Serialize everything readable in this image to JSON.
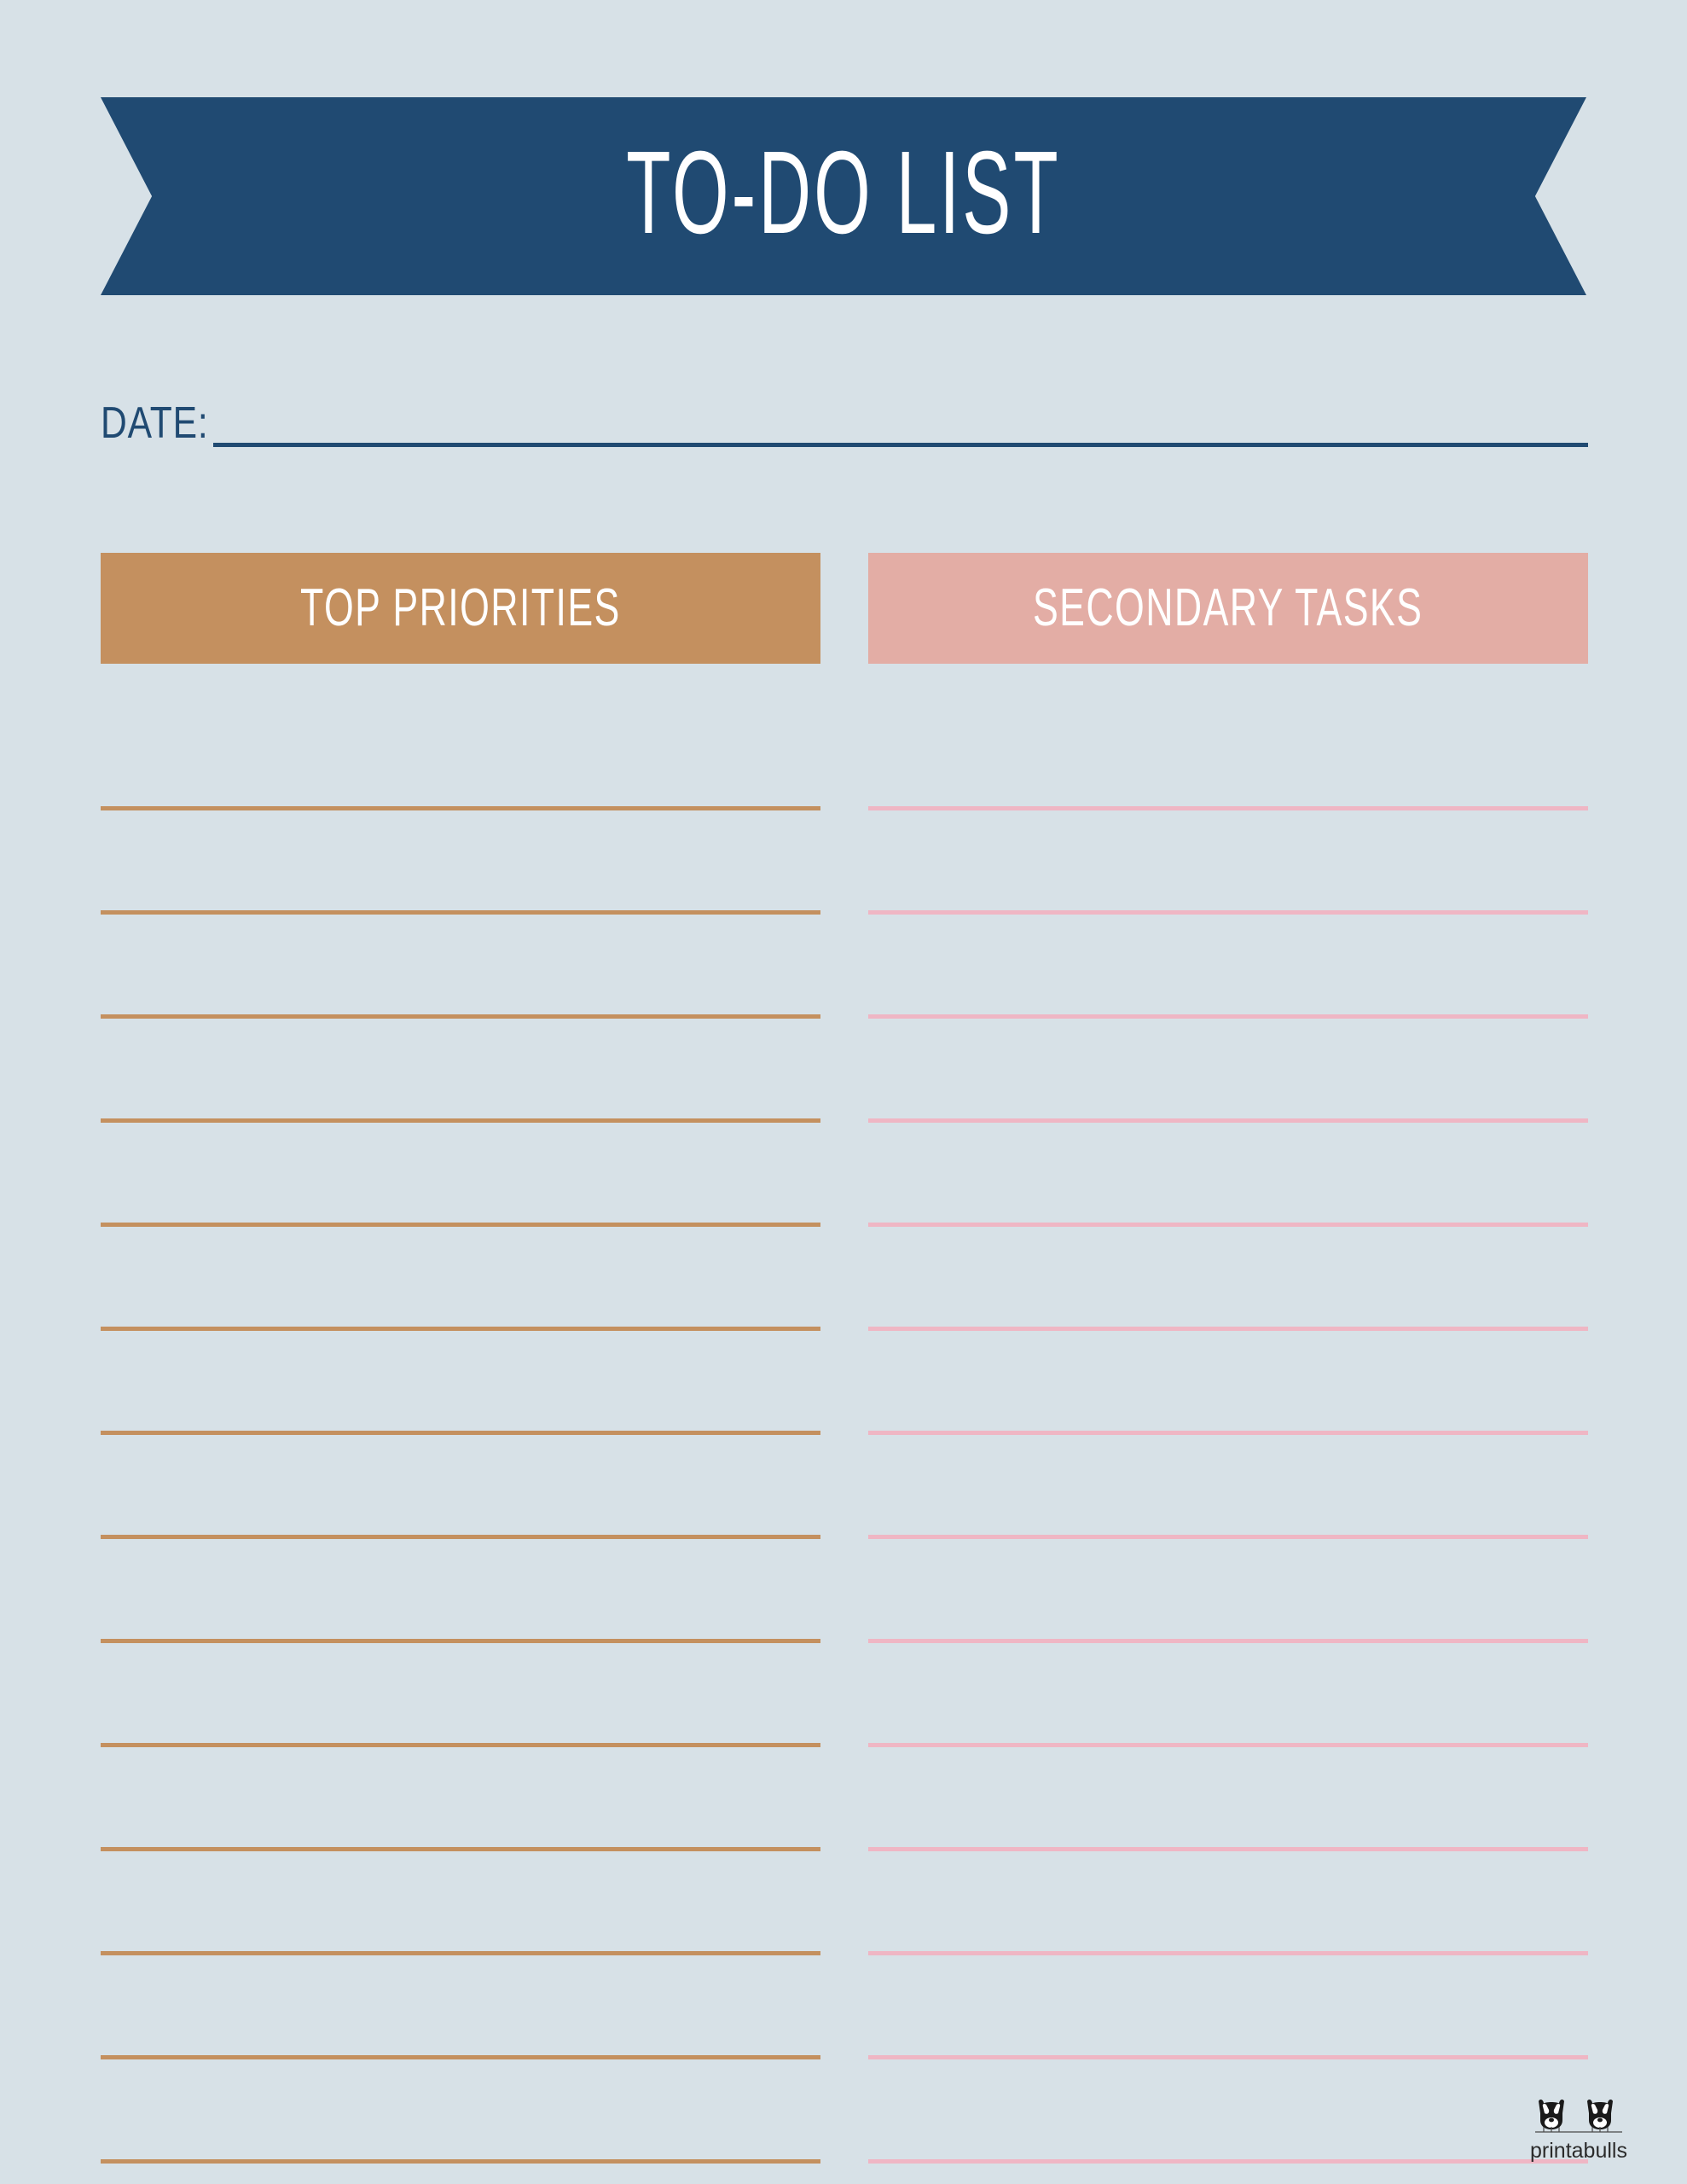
{
  "document": {
    "title": "TO-DO LIST",
    "background_color": "#d7e1e7"
  },
  "banner": {
    "title": "TO-DO LIST",
    "background_color": "#204a72",
    "text_color": "#ffffff"
  },
  "date_field": {
    "label": "DATE:",
    "value": "",
    "placeholder": "",
    "line_color": "#204a72"
  },
  "columns": [
    {
      "id": "top-priorities",
      "header": "TOP PRIORITIES",
      "header_color": "#c4905f",
      "line_color": "#c4905f",
      "line_count": 14,
      "entries": [
        "",
        "",
        "",
        "",
        "",
        "",
        "",
        "",
        "",
        "",
        "",
        "",
        "",
        ""
      ]
    },
    {
      "id": "secondary-tasks",
      "header": "SECONDARY TASKS",
      "header_color": "#e3ada5",
      "line_color": "#efb6c4",
      "line_count": 14,
      "entries": [
        "",
        "",
        "",
        "",
        "",
        "",
        "",
        "",
        "",
        "",
        "",
        "",
        "",
        ""
      ]
    }
  ],
  "logo": {
    "text": "printabulls",
    "icon": "two-bulldog-faces-icon"
  }
}
